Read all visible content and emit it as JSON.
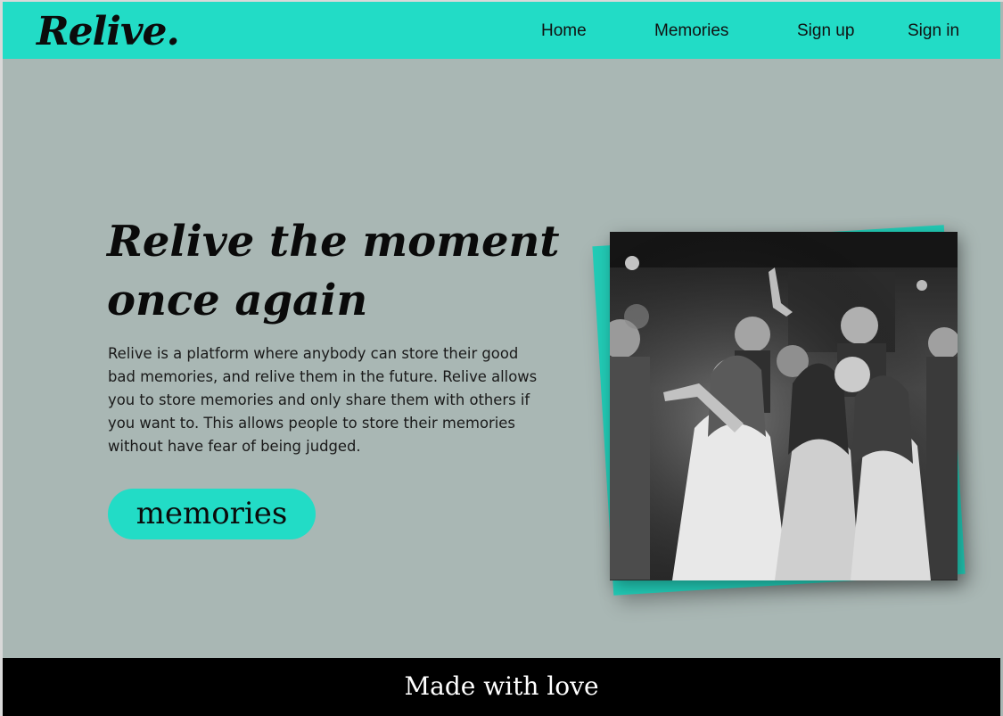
{
  "brand": {
    "logo_text": "Relive."
  },
  "nav": {
    "home": "Home",
    "memories": "Memories",
    "signup": "Sign up",
    "signin": "Sign in"
  },
  "hero": {
    "title_line1": "Relive the moment",
    "title_line2": "once again",
    "description": "Relive is a platform where anybody can store their good bad memories, and relive them in the future. Relive allows you to store memories and only share them with others if you want to. This allows people to store their memories without have fear of being judged.",
    "cta_label": "memories",
    "image": "group-celebration-photo"
  },
  "footer": {
    "text": "Made with love"
  },
  "colors": {
    "accent": "#22dcc6",
    "background": "#a9b7b4",
    "footer": "#000000"
  }
}
